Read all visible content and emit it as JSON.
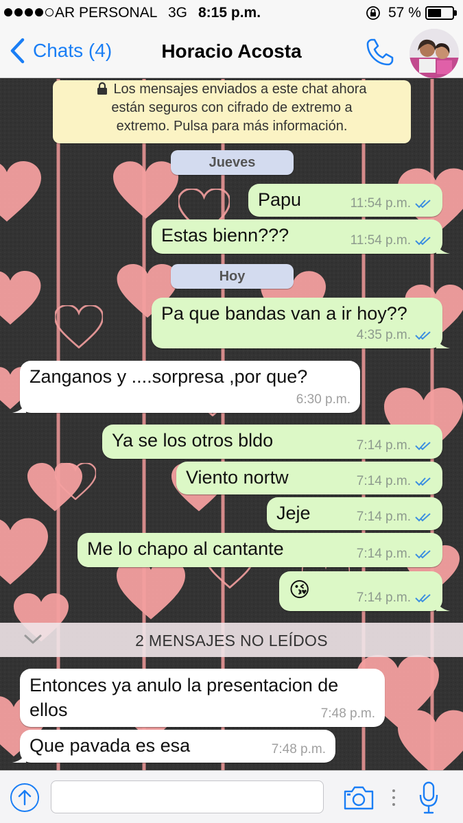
{
  "status_bar": {
    "carrier": "AR PERSONAL",
    "network": "3G",
    "time": "8:15 p.m.",
    "battery": "57 %",
    "battery_level": 0.57,
    "signal_bars": 4,
    "icons": [
      "signal-dots-icon",
      "orientation-lock-icon",
      "battery-icon"
    ]
  },
  "nav": {
    "back_label": "Chats (4)",
    "contact_name": "Horacio Acosta",
    "icons": [
      "chevron-left-icon",
      "phone-icon",
      "avatar"
    ]
  },
  "encryption_notice": {
    "line1": "Los mensajes enviados a este chat ahora",
    "line2": "están seguros con cifrado de extremo a",
    "line3": "extremo. Pulsa para más información.",
    "icon": "lock-icon"
  },
  "date_separators": [
    "Jueves",
    "Hoy"
  ],
  "messages": [
    {
      "direction": "out",
      "text": "Papu",
      "time": "11:54 p.m.",
      "status": "read"
    },
    {
      "direction": "out",
      "text": "Estas bienn???",
      "time": "11:54 p.m.",
      "status": "read"
    },
    {
      "direction": "out",
      "text": "Pa que bandas van a ir hoy??",
      "time": "4:35 p.m.",
      "status": "read"
    },
    {
      "direction": "in",
      "text": "Zanganos y ....sorpresa ,por que?",
      "time": "6:30 p.m."
    },
    {
      "direction": "out",
      "text": "Ya se los otros bldo",
      "time": "7:14 p.m.",
      "status": "read"
    },
    {
      "direction": "out",
      "text": "Viento nortw",
      "time": "7:14 p.m.",
      "status": "read"
    },
    {
      "direction": "out",
      "text": "Jeje",
      "time": "7:14 p.m.",
      "status": "read"
    },
    {
      "direction": "out",
      "text": "Me lo chapo al cantante",
      "time": "7:14 p.m.",
      "status": "read"
    },
    {
      "direction": "out",
      "text": "😘",
      "time": "7:14 p.m.",
      "status": "read"
    },
    {
      "direction": "in",
      "text": "Entonces ya anulo la presentacion de ellos",
      "time": "7:48 p.m."
    },
    {
      "direction": "in",
      "text": "Que pavada es esa",
      "time": "7:48 p.m."
    }
  ],
  "unread_banner": "2 MENSAJES NO LEÍDOS",
  "input_bar": {
    "placeholder": "",
    "value": "",
    "icons": [
      "upload-icon",
      "camera-icon",
      "more-icon",
      "microphone-icon"
    ]
  },
  "colors": {
    "accent": "#1a7ef5",
    "outgoing_bubble": "#dcf8c6",
    "incoming_bubble": "#ffffff",
    "read_ticks": "#3d8fe0",
    "wallpaper_heart": "#f4a0a0",
    "wallpaper_bg": "#2f2f2f",
    "encryption_bg": "#fbf3c4",
    "date_pill_bg": "#d3dbef"
  }
}
